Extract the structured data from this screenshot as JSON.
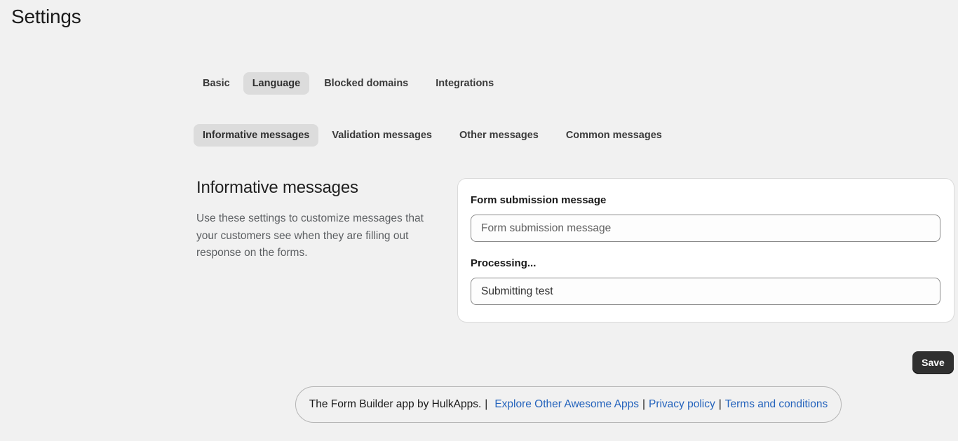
{
  "page": {
    "title": "Settings"
  },
  "main_tabs": [
    {
      "label": "Basic",
      "active": false
    },
    {
      "label": "Language",
      "active": true
    },
    {
      "label": "Blocked domains",
      "active": false
    },
    {
      "label": "Integrations",
      "active": false
    }
  ],
  "sub_tabs": [
    {
      "label": "Informative messages",
      "active": true
    },
    {
      "label": "Validation messages",
      "active": false
    },
    {
      "label": "Other messages",
      "active": false
    },
    {
      "label": "Common messages",
      "active": false
    }
  ],
  "section": {
    "heading": "Informative messages",
    "description": "Use these settings to customize messages that your customers see when they are filling out response on the forms."
  },
  "form": {
    "submission_label": "Form submission message",
    "submission_placeholder": "Form submission message",
    "submission_value": "",
    "processing_label": "Processing...",
    "processing_value": "Submitting test"
  },
  "actions": {
    "save_label": "Save"
  },
  "footer": {
    "credit": "The Form Builder app by HulkApps.",
    "separator": "|",
    "links": [
      {
        "label": "Explore Other Awesome Apps"
      },
      {
        "label": "Privacy policy"
      },
      {
        "label": "Terms and conditions"
      }
    ]
  },
  "colors": {
    "background": "#f1f1f1",
    "active_tab": "#dcdcdc",
    "link": "#2463bc",
    "primary_button": "#303030"
  }
}
